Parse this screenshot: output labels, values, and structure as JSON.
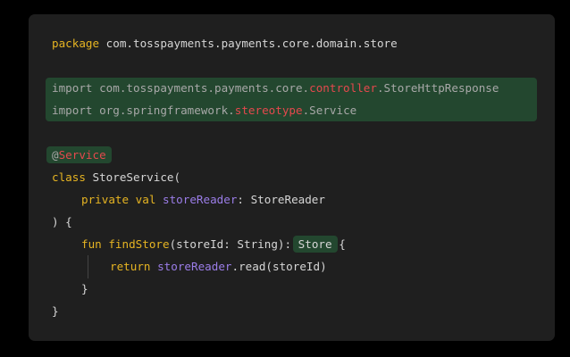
{
  "code": {
    "package_kw": "package",
    "package_name": "com.tosspayments.payments.core.domain.store",
    "import1": {
      "kw": "import",
      "prefix": "com.tosspayments.payments.core.",
      "highlight": "controller",
      "suffix": ".StoreHttpResponse"
    },
    "import2": {
      "kw": "import",
      "prefix": "org.springframework.",
      "highlight": "stereotype",
      "suffix": ".Service"
    },
    "annotation": {
      "at": "@",
      "name": "Service"
    },
    "class_decl": {
      "kw": "class",
      "rest": "StoreService("
    },
    "ctor_param": {
      "kw": "private val",
      "name": "storeReader",
      "rest": ": StoreReader"
    },
    "close_ctor": ") {",
    "fun_decl": {
      "kw": "fun",
      "name": "findStore",
      "params": "(storeId: String):",
      "return_type": "Store",
      "brace": "{"
    },
    "return_line": {
      "kw": "return",
      "receiver": "storeReader",
      "rest": ".read(storeId)"
    },
    "close_fun": "}",
    "close_class": "}"
  },
  "colors": {
    "background": "#000000",
    "panel": "#1f1f1f",
    "keyword": "#e6b422",
    "property": "#9b7de8",
    "highlight_text": "#e5484d",
    "highlight_bg": "#23472f"
  }
}
